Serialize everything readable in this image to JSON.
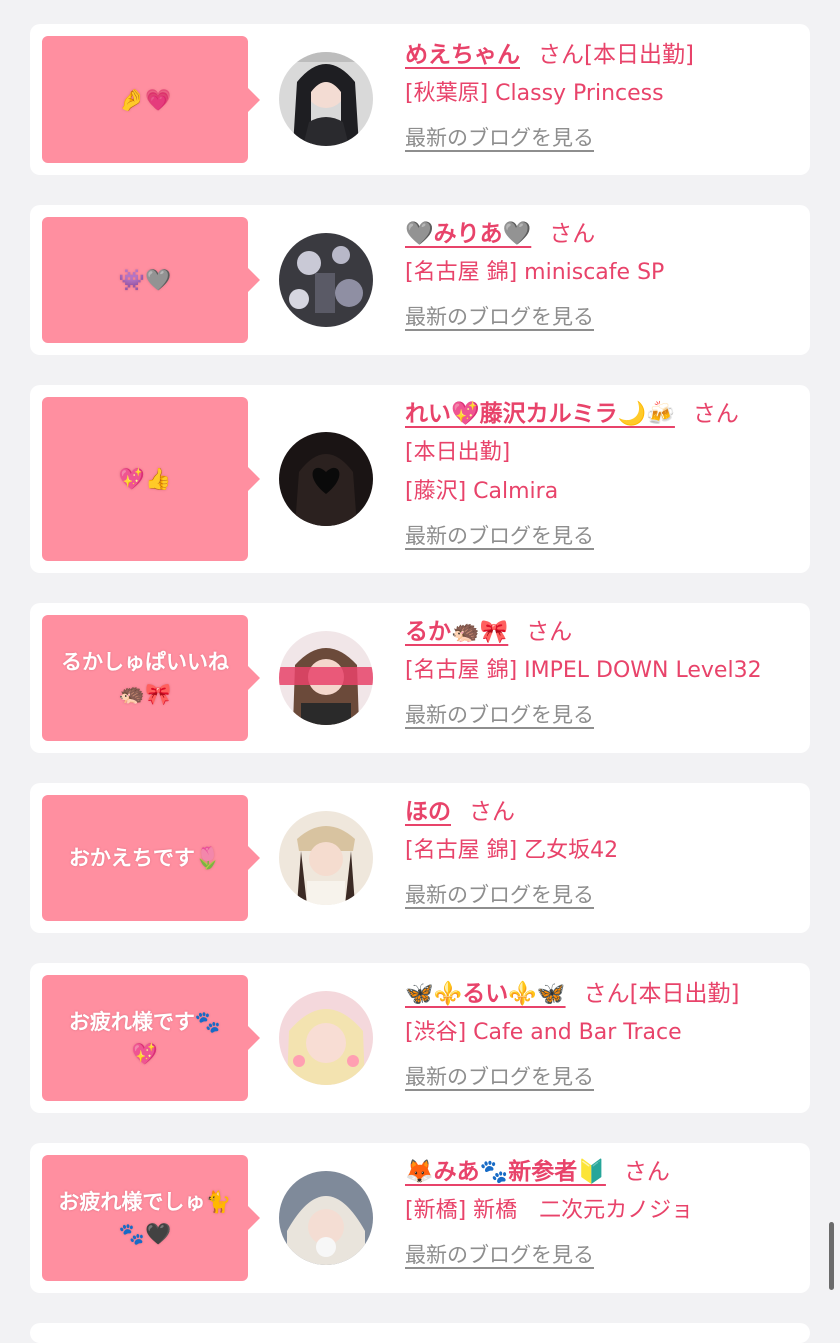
{
  "san_label": "さん",
  "blog_link": "最新のブログを見る",
  "cards": [
    {
      "message": "🤌💗",
      "name": "めえちゃん",
      "today": "[本日出勤]",
      "lines": [
        "[秋葉原] Classy Princess"
      ]
    },
    {
      "message": "👾🩶",
      "name": "🩶みりあ🩶",
      "today": "",
      "lines": [
        "[名古屋 錦] miniscafe SP"
      ]
    },
    {
      "message": "💖👍",
      "name": "れい💖藤沢カルミラ🌙🍻",
      "today": "",
      "lines": [
        "[本日出勤]",
        "[藤沢] Calmira"
      ]
    },
    {
      "message": "るかしゅぱいいね\n🦔🎀",
      "name": "るか🦔🎀",
      "today": "",
      "lines": [
        "[名古屋 錦] IMPEL DOWN Level32"
      ]
    },
    {
      "message": "おかえちです🌷",
      "name": "ほの",
      "today": "",
      "lines": [
        "[名古屋 錦] 乙女坂42"
      ]
    },
    {
      "message": "お疲れ様です🐾\n💖",
      "name": "🦋⚜️るい⚜️🦋",
      "today": "[本日出勤]",
      "lines": [
        "[渋谷] Cafe and Bar Trace"
      ]
    },
    {
      "message": "お疲れ様でしゅ🐈\n🐾🖤",
      "name": "🦊みあ🐾新参者🔰",
      "today": "",
      "lines": [
        "[新橋] 新橋　二次元カノジョ"
      ]
    }
  ],
  "colors": {
    "accent": "#e8436a",
    "bubble": "#ff8fa0",
    "background": "#f2f2f4",
    "link_gray": "#8e8e8e"
  }
}
